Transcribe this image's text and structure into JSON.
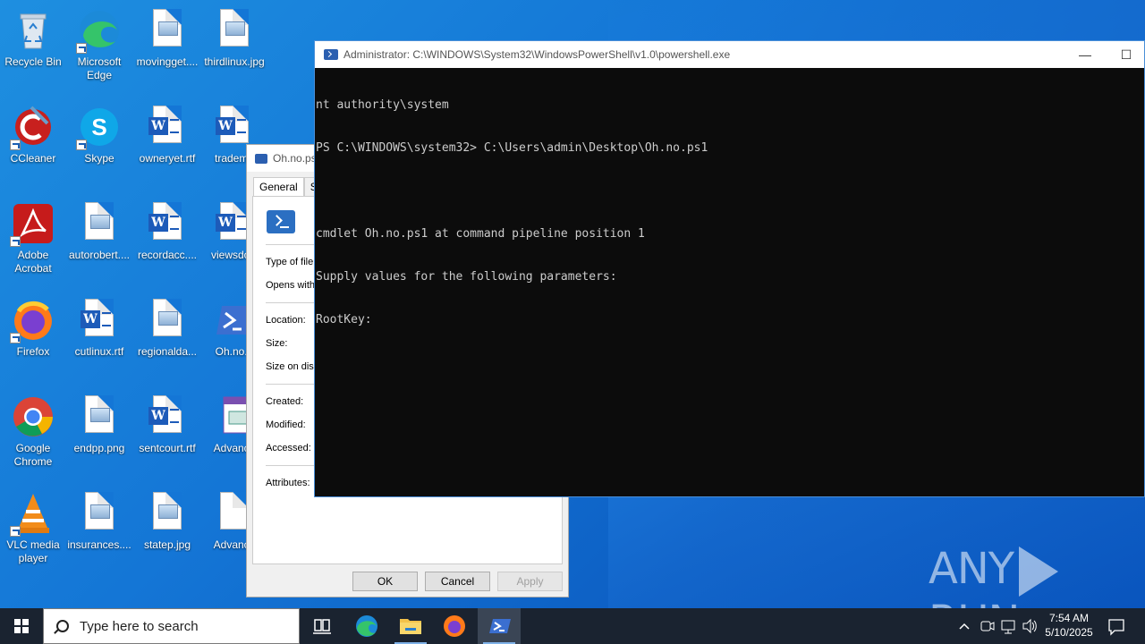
{
  "desktop": {
    "icons": [
      {
        "label": "Recycle Bin",
        "icon": "recycle-bin-icon"
      },
      {
        "label": "Microsoft Edge",
        "icon": "edge-icon"
      },
      {
        "label": "movingget....",
        "icon": "image-file-icon"
      },
      {
        "label": "thirdlinux.jpg",
        "icon": "image-file-icon"
      },
      {
        "label": "CCleaner",
        "icon": "ccleaner-icon"
      },
      {
        "label": "Skype",
        "icon": "skype-icon"
      },
      {
        "label": "owneryet.rtf",
        "icon": "word-doc-icon"
      },
      {
        "label": "tradema",
        "icon": "word-doc-icon"
      },
      {
        "label": "Adobe Acrobat",
        "icon": "acrobat-icon"
      },
      {
        "label": "autorobert....",
        "icon": "image-file-icon"
      },
      {
        "label": "recordacc....",
        "icon": "word-doc-icon"
      },
      {
        "label": "viewsdow",
        "icon": "word-doc-icon"
      },
      {
        "label": "Firefox",
        "icon": "firefox-icon"
      },
      {
        "label": "cutlinux.rtf",
        "icon": "word-doc-icon"
      },
      {
        "label": "regionalda...",
        "icon": "image-file-icon"
      },
      {
        "label": "Oh.no.p",
        "icon": "powershell-script-icon"
      },
      {
        "label": "Google Chrome",
        "icon": "chrome-icon"
      },
      {
        "label": "endpp.png",
        "icon": "image-file-icon"
      },
      {
        "label": "sentcourt.rtf",
        "icon": "word-doc-icon"
      },
      {
        "label": "Advance",
        "icon": "installer-icon"
      },
      {
        "label": "VLC media player",
        "icon": "vlc-icon"
      },
      {
        "label": "insurances....",
        "icon": "image-file-icon"
      },
      {
        "label": "statep.jpg",
        "icon": "image-file-icon"
      },
      {
        "label": "Advance",
        "icon": "blank-file-icon"
      }
    ]
  },
  "powershell": {
    "title": "Administrator: C:\\WINDOWS\\System32\\WindowsPowerShell\\v1.0\\powershell.exe",
    "minimize": "—",
    "maximize": "☐",
    "console_lines": [
      "nt authority\\system",
      "PS C:\\WINDOWS\\system32> C:\\Users\\admin\\Desktop\\Oh.no.ps1",
      "",
      "cmdlet Oh.no.ps1 at command pipeline position 1",
      "Supply values for the following parameters:",
      "RootKey:"
    ]
  },
  "properties": {
    "title": "Oh.no.ps",
    "tabs": [
      "General",
      "Se"
    ],
    "labels": {
      "type": "Type of file:",
      "opens": "Opens with:",
      "location": "Location:",
      "size": "Size:",
      "size_disk": "Size on disk",
      "created": "Created:",
      "modified": "Modified:",
      "accessed": "Accessed:",
      "attributes": "Attributes:"
    },
    "buttons": {
      "ok": "OK",
      "cancel": "Cancel",
      "apply": "Apply"
    }
  },
  "watermark": {
    "left": "ANY",
    "right": "RUN"
  },
  "taskbar": {
    "search_placeholder": "Type here to search",
    "time": "7:54 AM",
    "date": "5/10/2025"
  }
}
